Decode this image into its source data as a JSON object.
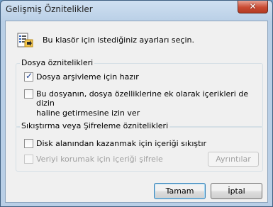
{
  "window": {
    "title": "Gelişmiş Öznitelikler",
    "close_label": "✕"
  },
  "intro": {
    "text": "Bu klasör için istediğiniz ayarları seçin."
  },
  "attributes_group": {
    "title": "Dosya öznitelikleri",
    "archive": {
      "label": "Dosya arşivleme için hazır",
      "checked": true
    },
    "index_line1": "Bu dosyanın, dosya özelliklerine ek olarak içerikleri de dizin",
    "index_line2": "haline getirmesine izin ver",
    "index_checked": false
  },
  "compress_group": {
    "title": "Sıkıştırma veya Şifreleme öznitelikleri",
    "compress": {
      "label": "Disk alanından kazanmak için içeriği sıkıştır",
      "checked": false
    },
    "encrypt": {
      "label": "Veriyi korumak için içeriği şifrele",
      "checked": false,
      "enabled": false
    },
    "details_button": "Ayrıntılar"
  },
  "buttons": {
    "ok": "Tamam",
    "cancel": "İptal"
  }
}
